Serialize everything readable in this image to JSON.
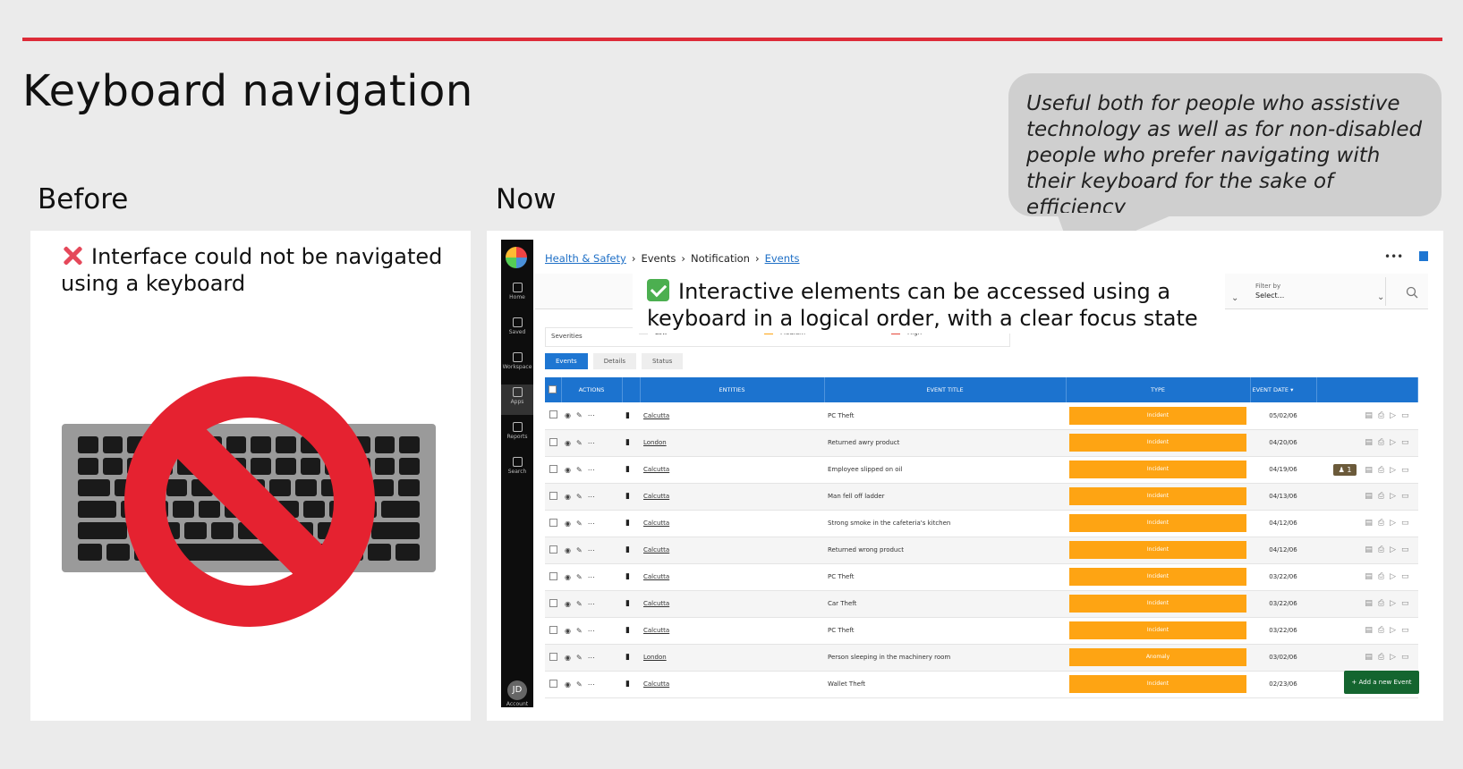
{
  "slide": {
    "title": "Keyboard navigation",
    "before_label": "Before",
    "now_label": "Now",
    "bubble_text": "Useful both for people who assistive technology as well as for non-disabled people who prefer navigating with their keyboard for the sake of efficiency",
    "before_caption": "Interface could not be navigated using a keyboard",
    "now_caption": "Interactive elements can be accessed using a keyboard in a logical order, with a clear focus state",
    "accent_color": "#dd2b38"
  },
  "app": {
    "sidebar": [
      {
        "label": "Home",
        "icon": "home-icon"
      },
      {
        "label": "Saved",
        "icon": "star-icon"
      },
      {
        "label": "Workspace",
        "icon": "workspace-icon"
      },
      {
        "label": "Apps",
        "icon": "apps-icon"
      },
      {
        "label": "Reports",
        "icon": "reports-icon"
      },
      {
        "label": "Search",
        "icon": "search-icon"
      }
    ],
    "account_initials": "JD",
    "account_label": "Account",
    "breadcrumb": [
      "Health & Safety",
      "Events",
      "Notification",
      "Events"
    ],
    "filter_by_label": "Filter by",
    "filter_by_value": "Select...",
    "severities_label": "Severities",
    "severity_levels": [
      "Low",
      "Medium",
      "High"
    ],
    "tabs": [
      "Events",
      "Details",
      "Status"
    ],
    "columns": [
      "ACTIONS",
      "ENTITIES",
      "EVENT TITLE",
      "TYPE",
      "EVENT DATE"
    ],
    "rows": [
      {
        "entity": "Calcutta",
        "title": "PC Theft",
        "type": "Incident",
        "date": "05/02/06"
      },
      {
        "entity": "London",
        "title": "Returned awry product",
        "type": "Incident",
        "date": "04/20/06"
      },
      {
        "entity": "Calcutta",
        "title": "Employee slipped on oil",
        "type": "Incident",
        "date": "04/19/06",
        "badge": "1"
      },
      {
        "entity": "Calcutta",
        "title": "Man fell off ladder",
        "type": "Incident",
        "date": "04/13/06"
      },
      {
        "entity": "Calcutta",
        "title": "Strong smoke in the cafeteria's kitchen",
        "type": "Incident",
        "date": "04/12/06"
      },
      {
        "entity": "Calcutta",
        "title": "Returned wrong product",
        "type": "Incident",
        "date": "04/12/06"
      },
      {
        "entity": "Calcutta",
        "title": "PC Theft",
        "type": "Incident",
        "date": "03/22/06"
      },
      {
        "entity": "Calcutta",
        "title": "Car Theft",
        "type": "Incident",
        "date": "03/22/06"
      },
      {
        "entity": "Calcutta",
        "title": "PC Theft",
        "type": "Incident",
        "date": "03/22/06"
      },
      {
        "entity": "London",
        "title": "Person sleeping in the machinery room",
        "type": "Anomaly",
        "date": "03/02/06"
      },
      {
        "entity": "Calcutta",
        "title": "Wallet Theft",
        "type": "Incident",
        "date": "02/23/06"
      }
    ],
    "add_button": "Add a new Event"
  }
}
